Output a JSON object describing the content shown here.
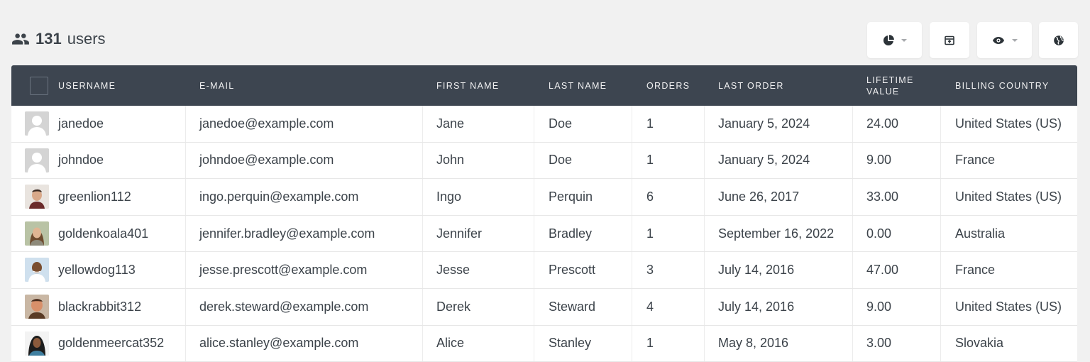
{
  "header": {
    "count": "131",
    "count_label": "users"
  },
  "toolbar": {
    "icons": [
      "pie-chart-icon",
      "export-icon",
      "eye-icon",
      "globe-icon"
    ]
  },
  "table": {
    "columns": [
      "Username",
      "E-mail",
      "First Name",
      "Last Name",
      "Orders",
      "Last Order",
      "Lifetime Value",
      "Billing Country"
    ],
    "rows": [
      {
        "avatar": "default",
        "username": "janedoe",
        "email": "janedoe@example.com",
        "first": "Jane",
        "last": "Doe",
        "orders": "1",
        "last_order": "January 5, 2024",
        "ltv": "24.00",
        "country": "United States (US)"
      },
      {
        "avatar": "default",
        "username": "johndoe",
        "email": "johndoe@example.com",
        "first": "John",
        "last": "Doe",
        "orders": "1",
        "last_order": "January 5, 2024",
        "ltv": "9.00",
        "country": "France"
      },
      {
        "avatar": "photo-1",
        "username": "greenlion112",
        "email": "ingo.perquin@example.com",
        "first": "Ingo",
        "last": "Perquin",
        "orders": "6",
        "last_order": "June 26, 2017",
        "ltv": "33.00",
        "country": "United States (US)"
      },
      {
        "avatar": "photo-2",
        "username": "goldenkoala401",
        "email": "jennifer.bradley@example.com",
        "first": "Jennifer",
        "last": "Bradley",
        "orders": "1",
        "last_order": "September 16, 2022",
        "ltv": "0.00",
        "country": "Australia"
      },
      {
        "avatar": "photo-3",
        "username": "yellowdog113",
        "email": "jesse.prescott@example.com",
        "first": "Jesse",
        "last": "Prescott",
        "orders": "3",
        "last_order": "July 14, 2016",
        "ltv": "47.00",
        "country": "France"
      },
      {
        "avatar": "photo-4",
        "username": "blackrabbit312",
        "email": "derek.steward@example.com",
        "first": "Derek",
        "last": "Steward",
        "orders": "4",
        "last_order": "July 14, 2016",
        "ltv": "9.00",
        "country": "United States (US)"
      },
      {
        "avatar": "photo-5",
        "username": "goldenmeercat352",
        "email": "alice.stanley@example.com",
        "first": "Alice",
        "last": "Stanley",
        "orders": "1",
        "last_order": "May 8, 2016",
        "ltv": "3.00",
        "country": "Slovakia"
      }
    ]
  },
  "colors": {
    "header_bg": "#3d4550",
    "page_bg": "#f1f1f1",
    "text": "#3c434a"
  }
}
